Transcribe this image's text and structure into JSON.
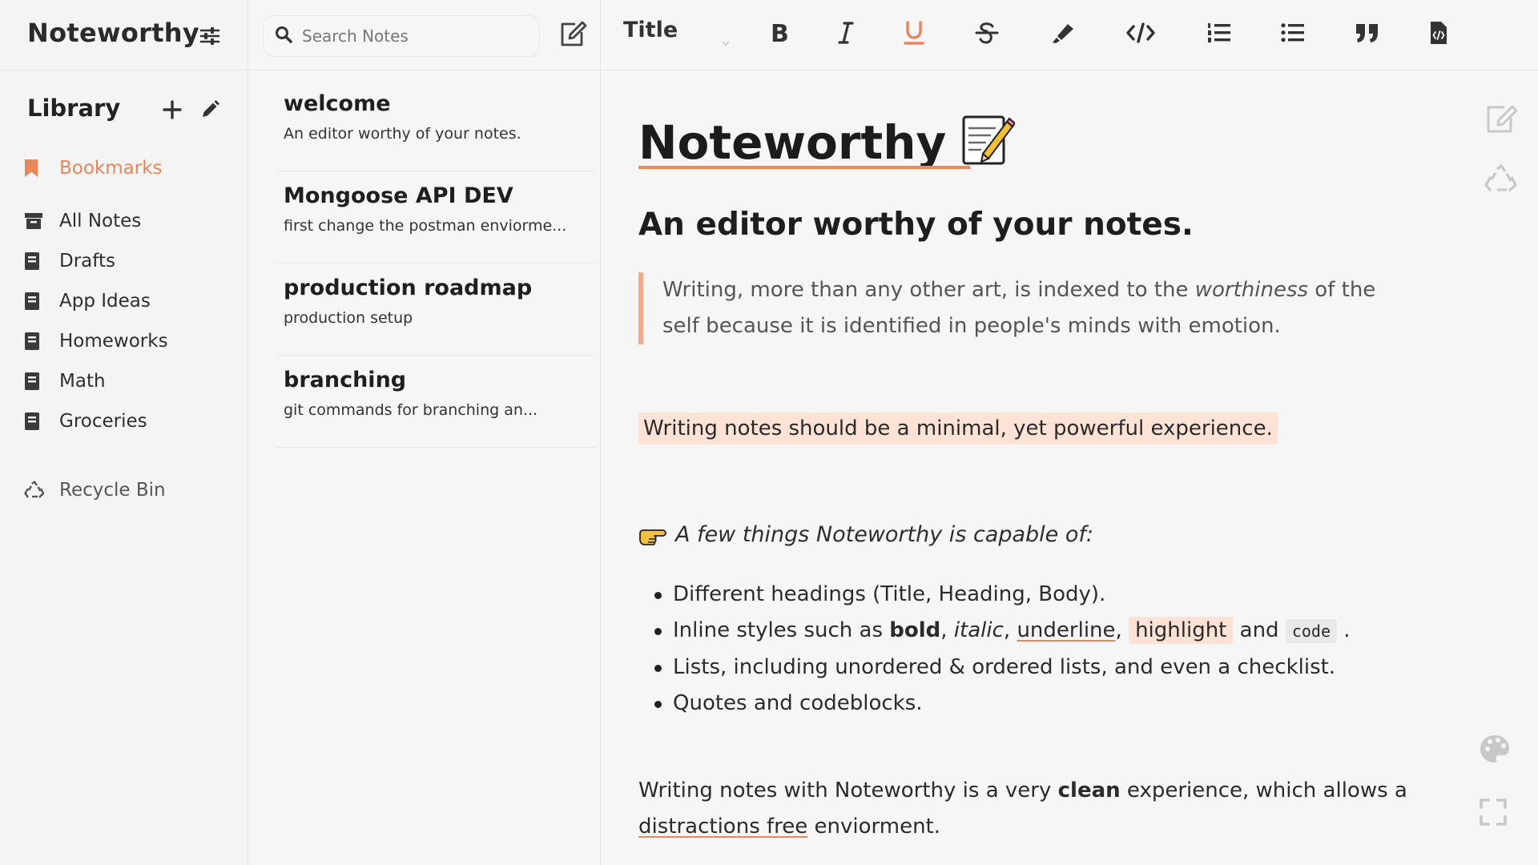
{
  "app": {
    "name": "Noteworthy"
  },
  "library": {
    "title": "Library"
  },
  "sidebar": {
    "items": [
      {
        "label": "Bookmarks",
        "icon": "bookmark-icon"
      },
      {
        "label": "All Notes",
        "icon": "archive-icon"
      },
      {
        "label": "Drafts",
        "icon": "notebook-icon"
      },
      {
        "label": "App Ideas",
        "icon": "notebook-icon"
      },
      {
        "label": "Homeworks",
        "icon": "notebook-icon"
      },
      {
        "label": "Math",
        "icon": "notebook-icon"
      },
      {
        "label": "Groceries",
        "icon": "notebook-icon"
      }
    ],
    "recycle": "Recycle Bin"
  },
  "search": {
    "placeholder": "Search Notes"
  },
  "notes": [
    {
      "title": "welcome",
      "snippet": "An editor worthy of your notes."
    },
    {
      "title": "Mongoose API DEV",
      "snippet": "first change the postman enviorme..."
    },
    {
      "title": "production roadmap",
      "snippet": "production setup"
    },
    {
      "title": "branching",
      "snippet": "git commands for branching an..."
    }
  ],
  "toolbar": {
    "heading_value": "Title",
    "tools": [
      "bold-icon",
      "italic-icon",
      "underline-icon",
      "strikethrough-icon",
      "highlighter-icon",
      "code-icon",
      "ordered-list-icon",
      "unordered-list-icon",
      "quote-icon",
      "codeblock-icon"
    ]
  },
  "doc": {
    "title": "Noteworthy",
    "subtitle": "An editor worthy of your notes.",
    "quote_1": " Writing, more than any other art, is indexed to the ",
    "quote_em": "worthiness",
    "quote_2": " of the self because it is identified in people's minds with emotion.",
    "highlight": "Writing notes should be a minimal, yet powerful experience.",
    "capable": "A few things Noteworthy is capable of:",
    "b1": "Different headings (Title, Heading, Body).",
    "b2_pre": "Inline styles such as ",
    "b2_bold": "bold",
    "b2_comma1": ", ",
    "b2_italic": "italic",
    "b2_comma2": ", ",
    "b2_underline": "underline",
    "b2_comma3": ", ",
    "b2_highlight": "highlight",
    "b2_and": " and ",
    "b2_code": "code",
    "b2_end": " .",
    "b3": "Lists, including unordered & ordered lists, and even a checklist.",
    "b4": "Quotes and codeblocks.",
    "closing_1": "Writing notes with Noteworthy is a very ",
    "closing_bold": "clean",
    "closing_2": " experience, which allows a ",
    "closing_link": "distractions free",
    "closing_3": " enviorment."
  },
  "colors": {
    "accent": "#e9875a",
    "highlight_bg": "#fde2d5",
    "quote_border": "#f0aa8c"
  }
}
